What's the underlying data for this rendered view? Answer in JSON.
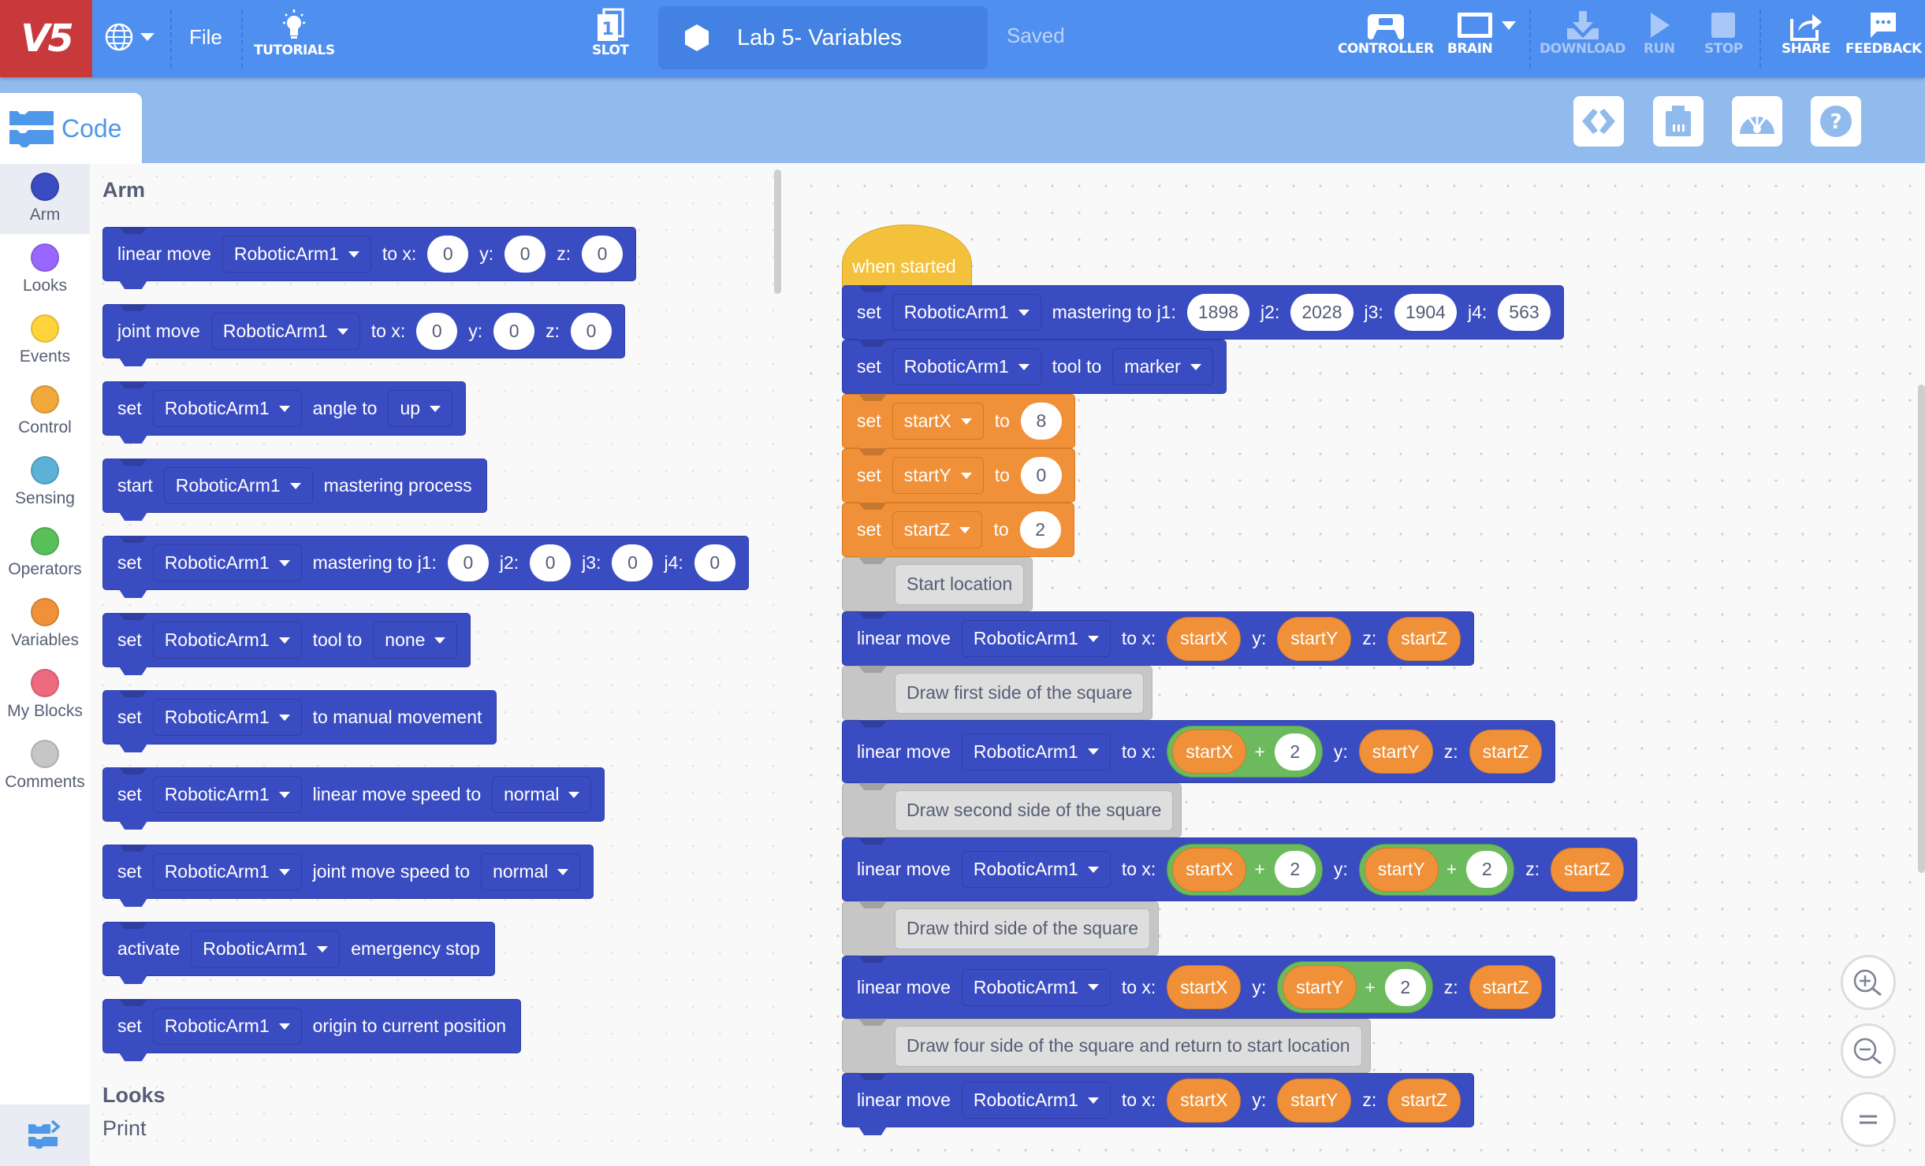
{
  "topbar": {
    "logo": "V5",
    "file_label": "File",
    "tutorials_label": "TUTORIALS",
    "slot_label": "SLOT",
    "slot_number": "1",
    "project_name": "Lab 5- Variables",
    "save_status": "Saved",
    "controller_label": "CONTROLLER",
    "brain_label": "BRAIN",
    "download_label": "DOWNLOAD",
    "run_label": "RUN",
    "stop_label": "STOP",
    "share_label": "SHARE",
    "feedback_label": "FEEDBACK"
  },
  "subbar": {
    "code_tab_label": "Code"
  },
  "categories": [
    {
      "label": "Arm",
      "color": "#3a4cc2"
    },
    {
      "label": "Looks",
      "color": "#9966ff"
    },
    {
      "label": "Events",
      "color": "#ffd43b"
    },
    {
      "label": "Control",
      "color": "#f2a93b"
    },
    {
      "label": "Sensing",
      "color": "#5cb1d6"
    },
    {
      "label": "Operators",
      "color": "#59c059"
    },
    {
      "label": "Variables",
      "color": "#f0913a"
    },
    {
      "label": "My Blocks",
      "color": "#ee6a7e"
    },
    {
      "label": "Comments",
      "color": "#c6c6c6"
    }
  ],
  "palette": {
    "arm_heading": "Arm",
    "looks_heading": "Looks",
    "print_label": "Print",
    "blocks": [
      {
        "parts": [
          "linear move",
          "RoboticArm1",
          "to x:",
          "0",
          "y:",
          "0",
          "z:",
          "0"
        ]
      },
      {
        "parts": [
          "joint move",
          "RoboticArm1",
          "to x:",
          "0",
          "y:",
          "0",
          "z:",
          "0"
        ]
      },
      {
        "parts": [
          "set",
          "RoboticArm1",
          "angle to",
          "up"
        ]
      },
      {
        "parts": [
          "start",
          "RoboticArm1",
          "mastering process"
        ]
      },
      {
        "parts": [
          "set",
          "RoboticArm1",
          "mastering to j1:",
          "0",
          "j2:",
          "0",
          "j3:",
          "0",
          "j4:",
          "0"
        ]
      },
      {
        "parts": [
          "set",
          "RoboticArm1",
          "tool to",
          "none"
        ]
      },
      {
        "parts": [
          "set",
          "RoboticArm1",
          "to manual movement"
        ]
      },
      {
        "parts": [
          "set",
          "RoboticArm1",
          "linear move speed to",
          "normal"
        ]
      },
      {
        "parts": [
          "set",
          "RoboticArm1",
          "joint move speed to",
          "normal"
        ]
      },
      {
        "parts": [
          "activate",
          "RoboticArm1",
          "emergency stop"
        ]
      },
      {
        "parts": [
          "set",
          "RoboticArm1",
          "origin to current position"
        ]
      }
    ]
  },
  "script": {
    "hat": "when started",
    "mastering": {
      "set": "set",
      "arm": "RoboticArm1",
      "label": "mastering to j1:",
      "j1": "1898",
      "j2_label": "j2:",
      "j2": "2028",
      "j3_label": "j3:",
      "j3": "1904",
      "j4_label": "j4:",
      "j4": "563"
    },
    "tool": {
      "set": "set",
      "arm": "RoboticArm1",
      "label": "tool to",
      "value": "marker"
    },
    "vars": [
      {
        "set": "set",
        "name": "startX",
        "to": "to",
        "value": "8"
      },
      {
        "set": "set",
        "name": "startY",
        "to": "to",
        "value": "0"
      },
      {
        "set": "set",
        "name": "startZ",
        "to": "to",
        "value": "2"
      }
    ],
    "comments": [
      "Start location",
      "Draw first side of the square",
      "Draw second side of the square",
      "Draw third side of the square",
      "Draw four side of the square and return to start location"
    ],
    "move_label": "linear move",
    "arm": "RoboticArm1",
    "to_x": "to x:",
    "y": "y:",
    "z": "z:",
    "plus": "+",
    "var_x": "startX",
    "var_y": "startY",
    "var_z": "startZ",
    "offset": "2"
  }
}
